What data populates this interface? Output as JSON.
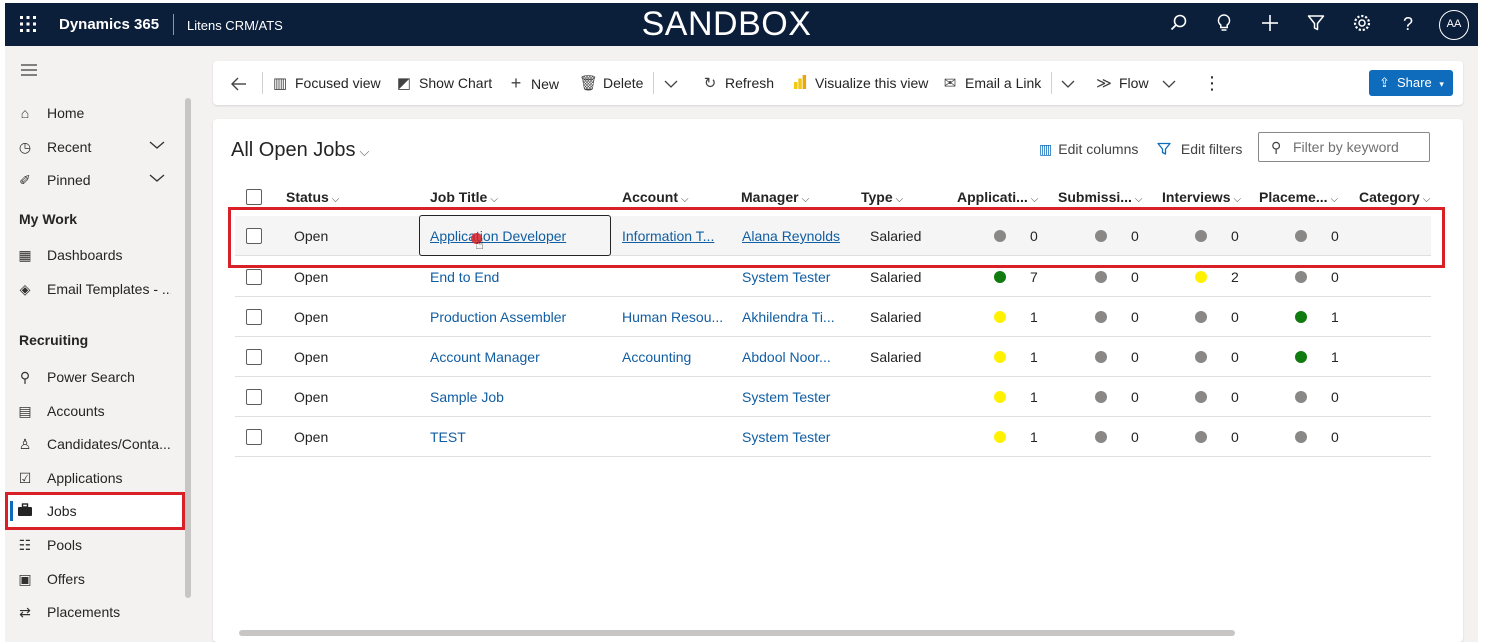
{
  "topbar": {
    "app_name": "Dynamics 365",
    "module_name": "Litens CRM/ATS",
    "env_label": "SANDBOX",
    "avatar_initials": "AA"
  },
  "sidebar": {
    "items_top": [
      {
        "label": "Home",
        "icon": "home-icon"
      },
      {
        "label": "Recent",
        "icon": "clock-icon"
      },
      {
        "label": "Pinned",
        "icon": "pin-icon"
      }
    ],
    "my_work_title": "My Work",
    "my_work_items": [
      {
        "label": "Dashboards",
        "icon": "dashboard-icon"
      },
      {
        "label": "Email Templates - ...",
        "icon": "layers-icon"
      }
    ],
    "recruiting_title": "Recruiting",
    "recruiting_items": [
      {
        "label": "Power Search",
        "icon": "search-icon"
      },
      {
        "label": "Accounts",
        "icon": "building-icon"
      },
      {
        "label": "Candidates/Conta...",
        "icon": "person-icon"
      },
      {
        "label": "Applications",
        "icon": "checkbox-icon"
      },
      {
        "label": "Jobs",
        "icon": "briefcase-icon",
        "active": true
      },
      {
        "label": "Pools",
        "icon": "group-icon"
      },
      {
        "label": "Offers",
        "icon": "document-icon"
      },
      {
        "label": "Placements",
        "icon": "people-swap-icon"
      }
    ]
  },
  "commandbar": {
    "focused_view": "Focused view",
    "show_chart": "Show Chart",
    "new": "New",
    "delete": "Delete",
    "refresh": "Refresh",
    "visualize": "Visualize this view",
    "email_link": "Email a Link",
    "flow": "Flow",
    "share": "Share"
  },
  "grid": {
    "view_title": "All Open Jobs",
    "edit_columns": "Edit columns",
    "edit_filters": "Edit filters",
    "filter_placeholder": "Filter by keyword",
    "columns": [
      "Status",
      "Job Title",
      "Account",
      "Manager",
      "Type",
      "Applicati...",
      "Submissi...",
      "Interviews",
      "Placeme...",
      "Category"
    ],
    "status_colors": {
      "grey": "#8a8886",
      "green": "#107c10",
      "yellow": "#fff100"
    },
    "rows": [
      {
        "status": "Open",
        "job_title": "Application Developer",
        "account": "Information T...",
        "manager": "Alana Reynolds",
        "type": "Salaried",
        "applications": {
          "value": "0",
          "color": "grey"
        },
        "submissions": {
          "value": "0",
          "color": "grey"
        },
        "interviews": {
          "value": "0",
          "color": "grey"
        },
        "placements": {
          "value": "0",
          "color": "grey"
        },
        "category": ""
      },
      {
        "status": "Open",
        "job_title": "End to End",
        "account": "",
        "manager": "System Tester",
        "type": "Salaried",
        "applications": {
          "value": "7",
          "color": "green"
        },
        "submissions": {
          "value": "0",
          "color": "grey"
        },
        "interviews": {
          "value": "2",
          "color": "yellow"
        },
        "placements": {
          "value": "0",
          "color": "grey"
        },
        "category": ""
      },
      {
        "status": "Open",
        "job_title": "Production Assembler",
        "account": "Human Resou...",
        "manager": "Akhilendra Ti...",
        "type": "Salaried",
        "applications": {
          "value": "1",
          "color": "yellow"
        },
        "submissions": {
          "value": "0",
          "color": "grey"
        },
        "interviews": {
          "value": "0",
          "color": "grey"
        },
        "placements": {
          "value": "1",
          "color": "green"
        },
        "category": ""
      },
      {
        "status": "Open",
        "job_title": "Account Manager",
        "account": "Accounting",
        "manager": "Abdool Noor...",
        "type": "Salaried",
        "applications": {
          "value": "1",
          "color": "yellow"
        },
        "submissions": {
          "value": "0",
          "color": "grey"
        },
        "interviews": {
          "value": "0",
          "color": "grey"
        },
        "placements": {
          "value": "1",
          "color": "green"
        },
        "category": ""
      },
      {
        "status": "Open",
        "job_title": "Sample Job",
        "account": "",
        "manager": "System Tester",
        "type": "",
        "applications": {
          "value": "1",
          "color": "yellow"
        },
        "submissions": {
          "value": "0",
          "color": "grey"
        },
        "interviews": {
          "value": "0",
          "color": "grey"
        },
        "placements": {
          "value": "0",
          "color": "grey"
        },
        "category": ""
      },
      {
        "status": "Open",
        "job_title": "TEST",
        "account": "",
        "manager": "System Tester",
        "type": "",
        "applications": {
          "value": "1",
          "color": "yellow"
        },
        "submissions": {
          "value": "0",
          "color": "grey"
        },
        "interviews": {
          "value": "0",
          "color": "grey"
        },
        "placements": {
          "value": "0",
          "color": "grey"
        },
        "category": ""
      }
    ]
  }
}
